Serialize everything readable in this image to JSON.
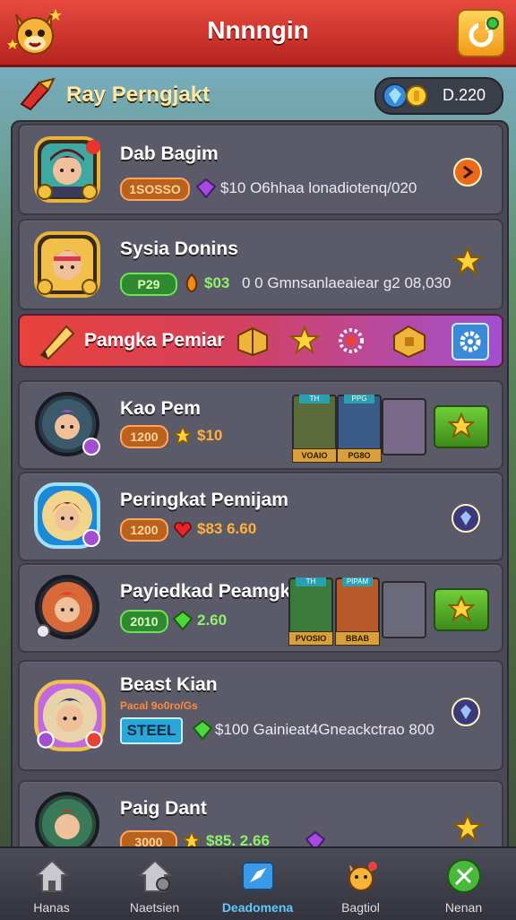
{
  "header": {
    "title": "Nnnngin"
  },
  "subheader": {
    "title": "Ray Perngjakt",
    "currency_value": "D.220"
  },
  "rows": [
    {
      "name": "Dab Bagim",
      "pill": "1SOSSO",
      "stat": "$10 O6hhaa lonadiotenq/020"
    },
    {
      "name": "Sysia Donins",
      "pill": "P29",
      "stat_green": "$03",
      "stat": "0 0 Gmnsanlaeaiear g2 08,030"
    },
    {
      "name": "Kao Pem",
      "pill": "1200",
      "stat_orange": "$10"
    },
    {
      "name": "Peringkat Pemijam",
      "pill": "1200",
      "stat_orange": "$83 6.60"
    },
    {
      "name": "Payiedkad Peamgkat",
      "pill": "2010",
      "stat_green": "2.60"
    },
    {
      "name": "Beast Kian",
      "sub": "Pacal 9o0ro/Gs",
      "pill": "STEEL",
      "stat": "$100 Gainieat4Gneackctrao 800"
    },
    {
      "name": "Paig Dant",
      "pill": "3000",
      "stat_green": "$85. 2.66"
    }
  ],
  "promo": {
    "label": "Pamgka Pemiar"
  },
  "minicards": {
    "a": [
      {
        "top": "TH",
        "label": "VOAIO"
      },
      {
        "top": "PPG",
        "label": "PG8O"
      }
    ],
    "b": [
      {
        "top": "TH",
        "label": "PVOSIO"
      },
      {
        "top": "PIPAM",
        "label": "BBAB"
      }
    ]
  },
  "nav": [
    {
      "label": "Hanas",
      "icon": "home-icon"
    },
    {
      "label": "Naetsien",
      "icon": "house-gear-icon"
    },
    {
      "label": "Deadomena",
      "icon": "map-icon",
      "active": true
    },
    {
      "label": "Bagtiol",
      "icon": "fox-icon"
    },
    {
      "label": "Nenan",
      "icon": "sword-icon"
    }
  ],
  "colors": {
    "header": "#d63a31",
    "panel": "#4a4a57",
    "accent": "#5fc8ff"
  }
}
